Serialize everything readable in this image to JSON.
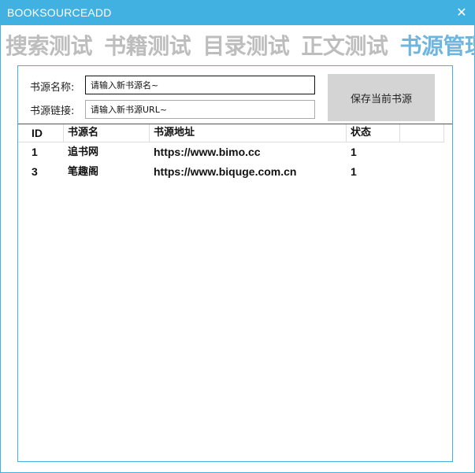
{
  "window": {
    "title": "BOOKSOURCEADD",
    "close_glyph": "✕",
    "accent_color": "#41b1e1"
  },
  "tabs": [
    {
      "label": "搜索测试",
      "active": false
    },
    {
      "label": "书籍测试",
      "active": false
    },
    {
      "label": "目录测试",
      "active": false
    },
    {
      "label": "正文测试",
      "active": false
    },
    {
      "label": "书源管理",
      "active": true
    }
  ],
  "form": {
    "name_label": "书源名称:",
    "name_value": "请输入新书源名~",
    "url_label": "书源链接:",
    "url_value": "请输入新书源URL~",
    "save_label": "保存当前书源"
  },
  "table": {
    "columns": [
      "ID",
      "书源名",
      "书源地址",
      "状态"
    ],
    "rows": [
      {
        "id": "1",
        "name": "追书网",
        "url": "https://www.bimo.cc",
        "status": "1"
      },
      {
        "id": "3",
        "name": "笔趣阁",
        "url": "https://www.biquge.com.cn",
        "status": "1"
      }
    ]
  }
}
